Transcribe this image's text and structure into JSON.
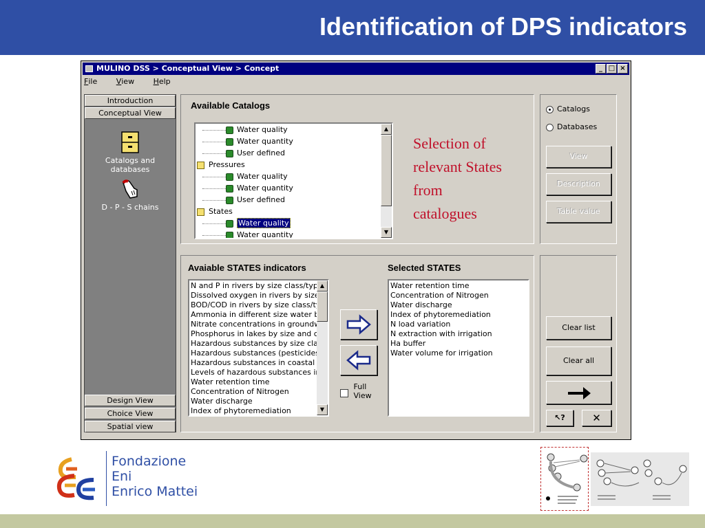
{
  "slide": {
    "title": "Identification of DPS indicators",
    "annotation_lines": [
      "Selection of",
      "relevant States",
      "from",
      "catalogues"
    ],
    "logo_lines": [
      "Fondazione",
      "Eni",
      "Enrico Mattei"
    ],
    "colors": {
      "header": "#2f4fa5",
      "annotation": "#c0102a",
      "footer": "#c3c8a0"
    }
  },
  "window": {
    "title": "MULINO DSS > Conceptual View > Concept",
    "controls": {
      "minimize": "_",
      "maximize": "□",
      "close": "×"
    },
    "menu": [
      {
        "label": "File",
        "mnemonic": "F",
        "rest": "ile"
      },
      {
        "label": "View",
        "mnemonic": "V",
        "rest": "iew"
      },
      {
        "label": "Help",
        "mnemonic": "H",
        "rest": "elp"
      }
    ]
  },
  "nav": {
    "top_buttons": [
      "Introduction",
      "Conceptual View"
    ],
    "tiles": [
      "Catalogs and databases",
      "D - P - S chains"
    ],
    "bottom_buttons": [
      "Design View",
      "Choice View",
      "Spatial view"
    ]
  },
  "catalogs": {
    "title": "Available Catalogs",
    "tree": [
      {
        "type": "leaf",
        "label": "Water quality"
      },
      {
        "type": "leaf",
        "label": "Water quantity"
      },
      {
        "type": "leaf",
        "label": "User defined"
      },
      {
        "type": "folder",
        "label": "Pressures"
      },
      {
        "type": "leaf",
        "label": "Water quality"
      },
      {
        "type": "leaf",
        "label": "Water quantity"
      },
      {
        "type": "leaf",
        "label": "User defined"
      },
      {
        "type": "folder",
        "label": "States"
      },
      {
        "type": "leaf",
        "label": "Water quality",
        "selected": true
      },
      {
        "type": "leaf",
        "label": "Water quantity"
      }
    ]
  },
  "source": {
    "options": [
      {
        "label": "Catalogs",
        "checked": true
      },
      {
        "label": "Databases",
        "checked": false
      }
    ],
    "buttons": [
      "View",
      "Description",
      "Table value"
    ]
  },
  "available_states": {
    "title": "Avaiable STATES indicators",
    "items": [
      "N and P in rivers by size class/type",
      "Dissolved oxygen in rivers by size cla",
      "BOD/COD in rivers by size class/typ",
      "Ammonia in different size water bodie",
      "Nitrate concentrations in groundwate",
      "Phosphorus in lakes by size and cate",
      "Hazardous substances by size class",
      "Hazardous substances (pesticides) in",
      "Hazardous substances in coastal an",
      "Levels of hazardous substances in n",
      "Water retention time",
      "Concentration of Nitrogen",
      "Water discharge",
      "Index of phytoremediation"
    ]
  },
  "selected_states": {
    "title": "Selected STATES",
    "items": [
      "Water retention time",
      "Concentration of Nitrogen",
      "Water discharge",
      "Index of phytoremediation",
      "N load variation",
      "N extraction with irrigation",
      "Ha buffer",
      "Water volume for irrigation"
    ]
  },
  "transfer": {
    "full_view_lines": [
      "Full",
      "View"
    ],
    "full_view_checked": false
  },
  "actions": {
    "clear_list": "Clear list",
    "clear_all": "Clear all",
    "help": "?",
    "close": "✕"
  }
}
